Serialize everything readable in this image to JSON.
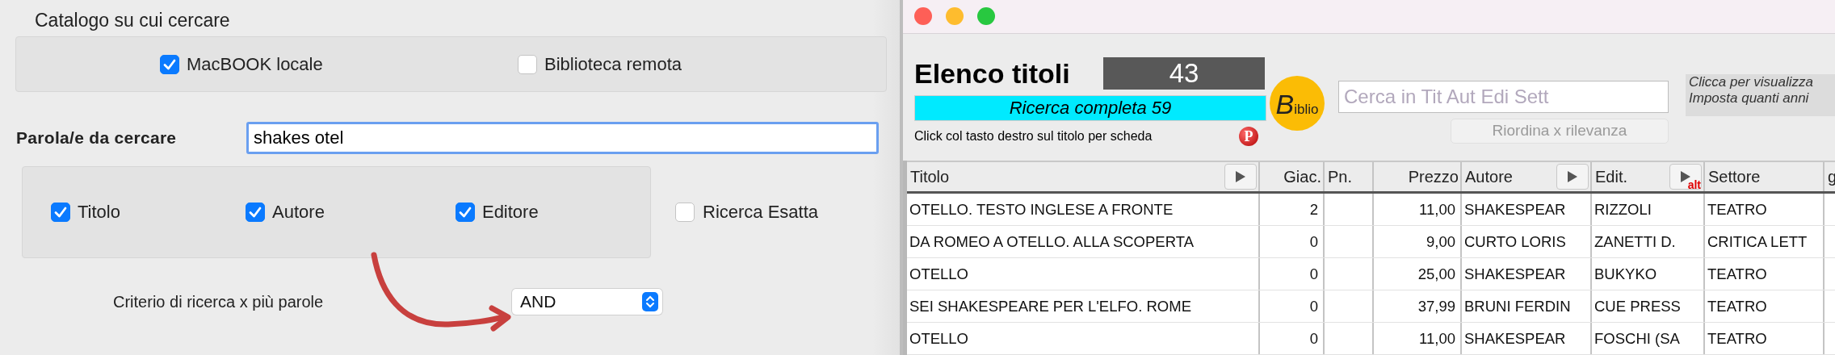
{
  "search_panel": {
    "catalog_title": "Catalogo su cui cercare",
    "catalogs": [
      {
        "label": "MacBOOK locale",
        "checked": true
      },
      {
        "label": "Biblioteca remota",
        "checked": false
      }
    ],
    "query_label": "Parola/e da cercare",
    "query_value": "shakes otel",
    "fields": [
      {
        "label": "Titolo",
        "checked": true
      },
      {
        "label": "Autore",
        "checked": true
      },
      {
        "label": "Editore",
        "checked": true
      }
    ],
    "exact": {
      "label": "Ricerca Esatta",
      "checked": false
    },
    "criterion_label": "Criterio di ricerca x più parole",
    "criterion_value": "AND"
  },
  "titles_window": {
    "title": "Elenco titoli",
    "count": "43",
    "status": "Ricerca completa  59",
    "hint": "Click col tasto destro sul titolo per scheda",
    "p_badge": "P",
    "logo_initial": "B",
    "logo_rest": "iblio",
    "search_placeholder": "Cerca in Tit Aut Edi Sett",
    "sort_button": {
      "label": "Riordina x rilevanza",
      "disabled": true
    },
    "side_note": [
      "Clicca per visualizza",
      "Imposta quanti anni"
    ],
    "table": {
      "columns": [
        {
          "label": "Titolo",
          "sort_button": true,
          "kind": "text"
        },
        {
          "label": "Giac.",
          "sort_button": false,
          "kind": "number"
        },
        {
          "label": "Pn.",
          "sort_button": false,
          "kind": "text"
        },
        {
          "label": "Prezzo",
          "sort_button": false,
          "kind": "number"
        },
        {
          "label": "Autore",
          "sort_button": true,
          "kind": "text"
        },
        {
          "label": "Edit.",
          "sort_button": true,
          "badge": "alt",
          "kind": "text"
        },
        {
          "label": "Settore",
          "sort_button": false,
          "kind": "text"
        },
        {
          "label": "g",
          "kind": "text"
        }
      ],
      "rows": [
        [
          "OTELLO. TESTO INGLESE A FRONTE",
          "2",
          "",
          "11,00",
          "SHAKESPEAR",
          "RIZZOLI",
          "TEATRO",
          ""
        ],
        [
          "DA ROMEO A OTELLO. ALLA SCOPERTA",
          "0",
          "",
          "9,00",
          "CURTO LORIS",
          "ZANETTI D.",
          "CRITICA LETT",
          ""
        ],
        [
          "OTELLO",
          "0",
          "",
          "25,00",
          "SHAKESPEAR",
          "BUKYKO",
          "TEATRO",
          ""
        ],
        [
          "SEI SHAKESPEARE PER L'ELFO. ROME",
          "0",
          "",
          "37,99",
          "BRUNI FERDIN",
          "CUE PRESS",
          "TEATRO",
          ""
        ],
        [
          "OTELLO",
          "0",
          "",
          "11,00",
          "SHAKESPEAR",
          "FOSCHI (SA",
          "TEATRO",
          ""
        ]
      ]
    }
  }
}
